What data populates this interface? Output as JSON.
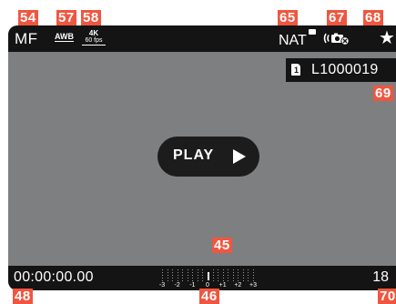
{
  "callouts": {
    "c54": "54",
    "c57": "57",
    "c58": "58",
    "c65": "65",
    "c67": "67",
    "c68": "68",
    "c69": "69",
    "c45": "45",
    "c48": "48",
    "c46": "46",
    "c70": "70"
  },
  "top_bar": {
    "focus_mode": "MF",
    "white_balance": "AWB",
    "resolution": "4K",
    "frame_rate": "60 fps",
    "film_style": "NAT",
    "stabilization_icon": "stabilization-off-icon",
    "favorite_icon": "star-icon"
  },
  "file_info": {
    "card_slot": "1",
    "filename": "L1000019"
  },
  "playback": {
    "label": "PLAY",
    "icon": "play-triangle-icon"
  },
  "bottom_bar": {
    "timecode": "00:00:00.00",
    "count": "18"
  },
  "exposure_scale": {
    "labels": [
      "-3",
      "-2",
      "-1",
      "0",
      "+1",
      "+2",
      "+3"
    ],
    "value": 0
  },
  "colors": {
    "callout": "#f0563f",
    "bar": "#141414",
    "screen": "#7d7f80"
  }
}
